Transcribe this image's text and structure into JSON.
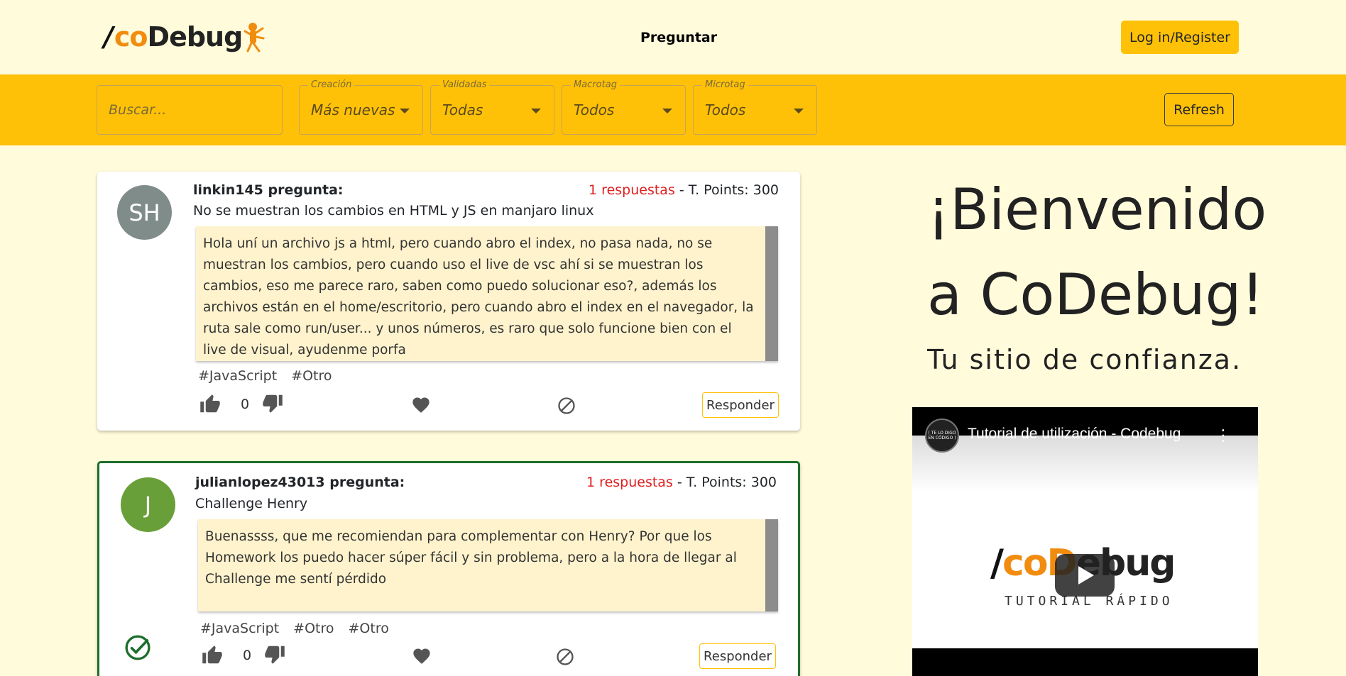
{
  "header": {
    "logo": {
      "slash": "/",
      "co": "co",
      "de": "De",
      "bug": "bug"
    },
    "nav_ask": "Preguntar",
    "login_label": "Log in/Register"
  },
  "filters": {
    "search_placeholder": "Buscar...",
    "selects": [
      {
        "legend": "Creación",
        "value": "Más nuevas"
      },
      {
        "legend": "Validadas",
        "value": "Todas"
      },
      {
        "legend": "Macrotag",
        "value": "Todos"
      },
      {
        "legend": "Microtag",
        "value": "Todos"
      }
    ],
    "refresh_label": "Refresh"
  },
  "posts": [
    {
      "avatar_initials": "SH",
      "avatar_color": "#808c8a",
      "author_line": "linkin145 pregunta:",
      "title": "No se muestran los cambios en HTML y JS en manjaro linux",
      "answers": "1 respuestas",
      "separator": " - ",
      "points": "T. Points: 300",
      "body": "Hola uní un archivo js a html, pero cuando abro el index, no pasa nada, no se muestran los cambios, pero cuando uso el live de vsc ahí si se muestran los cambios, eso me parece raro, saben como puedo solucionar eso?, además los archivos están en el home/escritorio, pero cuando abro el index en el navegador, la ruta sale como run/user... y unos números, es raro que solo funcione bien con el live de visual, ayudenme porfa",
      "tags": [
        "#JavaScript",
        "#Otro"
      ],
      "likes": "0",
      "respond_label": "Responder",
      "validated": false
    },
    {
      "avatar_initials": "J",
      "avatar_color": "#689f38",
      "author_line": "julianlopez43013 pregunta:",
      "title": "Challenge Henry",
      "answers": "1 respuestas",
      "separator": " - ",
      "points": "T. Points: 300",
      "body": "Buenassss, que me recomiendan para complementar con Henry? Por que los Homework los puedo hacer súper fácil y sin problema, pero a la hora de llegar al Challenge me sentí pérdido",
      "tags": [
        "#JavaScript",
        "#Otro",
        "#Otro"
      ],
      "likes": "0",
      "respond_label": "Responder",
      "validated": true
    }
  ],
  "welcome": {
    "line1": "¡Bienvenido",
    "line2": "a CoDebug!",
    "tagline": "Tu sitio de confianza."
  },
  "video": {
    "channel_text": "( TE LO DIGO EN CÓDIGO )",
    "title": "Tutorial de utilización - Codebug",
    "more": "⋮",
    "logo_slash": "/",
    "logo_co": "coD",
    "logo_ebug": "ebug",
    "subtitle": "TUTORIAL RÁPIDO"
  },
  "colors": {
    "accent": "#ffc107",
    "background": "#fffbdb",
    "answers_red": "#e01f1f",
    "validated_green": "#1d6e2c"
  }
}
